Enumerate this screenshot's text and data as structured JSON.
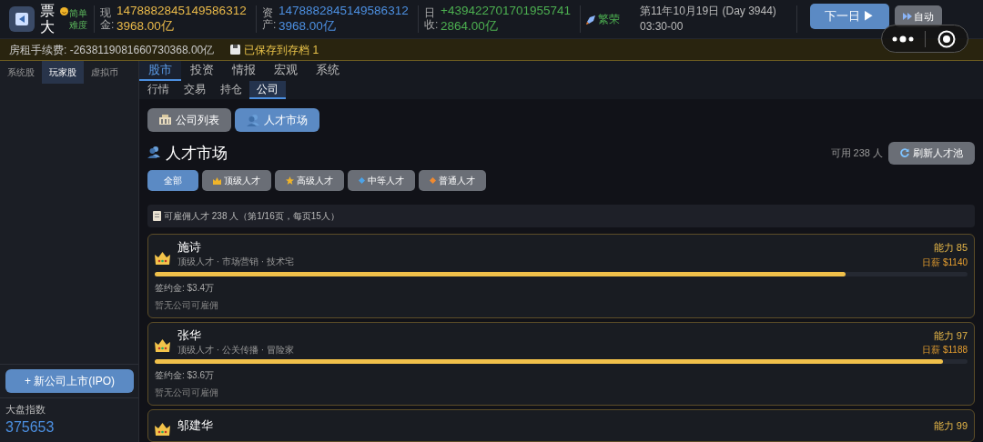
{
  "header": {
    "title": "票大",
    "difficulty": "简单难度",
    "stats": [
      {
        "label": "现金:",
        "value": "14788828451495863123968.00亿",
        "kind": "cash"
      },
      {
        "label": "资产:",
        "value": "14788828451495863123968.00亿",
        "kind": "asset"
      },
      {
        "label": "日收:",
        "value": "+4394227017019557412864.00亿",
        "kind": "income"
      }
    ],
    "economy": "繁荣",
    "date": "第11年10月19日 (Day 3944)",
    "time": "03:30-00",
    "next_button": "下一日 ▶",
    "auto_button": "自动"
  },
  "fee_bar": {
    "fee": "房租手续费: -2638119081660730368.00亿",
    "saved": "已保存到存档 1"
  },
  "sidebar": {
    "tabs": [
      {
        "label": "系统股",
        "selected": false
      },
      {
        "label": "玩家股",
        "selected": true
      },
      {
        "label": "虚拟币",
        "selected": false
      }
    ],
    "ipo_button": "+ 新公司上市(IPO)",
    "index_label": "大盘指数",
    "index_value": "375653"
  },
  "main_tabs": [
    {
      "label": "股市",
      "selected": true
    },
    {
      "label": "投资",
      "selected": false
    },
    {
      "label": "情报",
      "selected": false
    },
    {
      "label": "宏观",
      "selected": false
    },
    {
      "label": "系统",
      "selected": false
    }
  ],
  "sub_tabs": [
    {
      "label": "行情",
      "selected": false
    },
    {
      "label": "交易",
      "selected": false
    },
    {
      "label": "持仓",
      "selected": false
    },
    {
      "label": "公司",
      "selected": true
    }
  ],
  "views": [
    {
      "label": "公司列表",
      "kind": "companies",
      "selected": false
    },
    {
      "label": "人才市场",
      "kind": "talent",
      "selected": true
    }
  ],
  "talent": {
    "title": "人才市场",
    "available": "可用 238 人",
    "refresh_button": "刷新人才池",
    "filters": [
      {
        "label": "全部",
        "kind": "all",
        "selected": true
      },
      {
        "label": "顶级人才",
        "kind": "top",
        "selected": false
      },
      {
        "label": "高级人才",
        "kind": "senior",
        "selected": false
      },
      {
        "label": "中等人才",
        "kind": "mid",
        "selected": false
      },
      {
        "label": "普通人才",
        "kind": "normal",
        "selected": false
      }
    ],
    "summary": "可雇佣人才 238 人（第1/16页，每页15人）",
    "candidates": [
      {
        "name": "施诗",
        "tags": "顶级人才 · 市场营销 · 技术宅",
        "ability": "能力 85",
        "salary": "日薪 $1140",
        "level": 0.85,
        "signing": "签约金: $3.4万",
        "status": "暂无公司可雇佣"
      },
      {
        "name": "张华",
        "tags": "顶级人才 · 公关传播 · 冒险家",
        "ability": "能力 97",
        "salary": "日薪 $1188",
        "level": 0.97,
        "signing": "签约金: $3.6万",
        "status": "暂无公司可雇佣"
      },
      {
        "name": "邬建华",
        "ability": "能力 99"
      }
    ]
  }
}
